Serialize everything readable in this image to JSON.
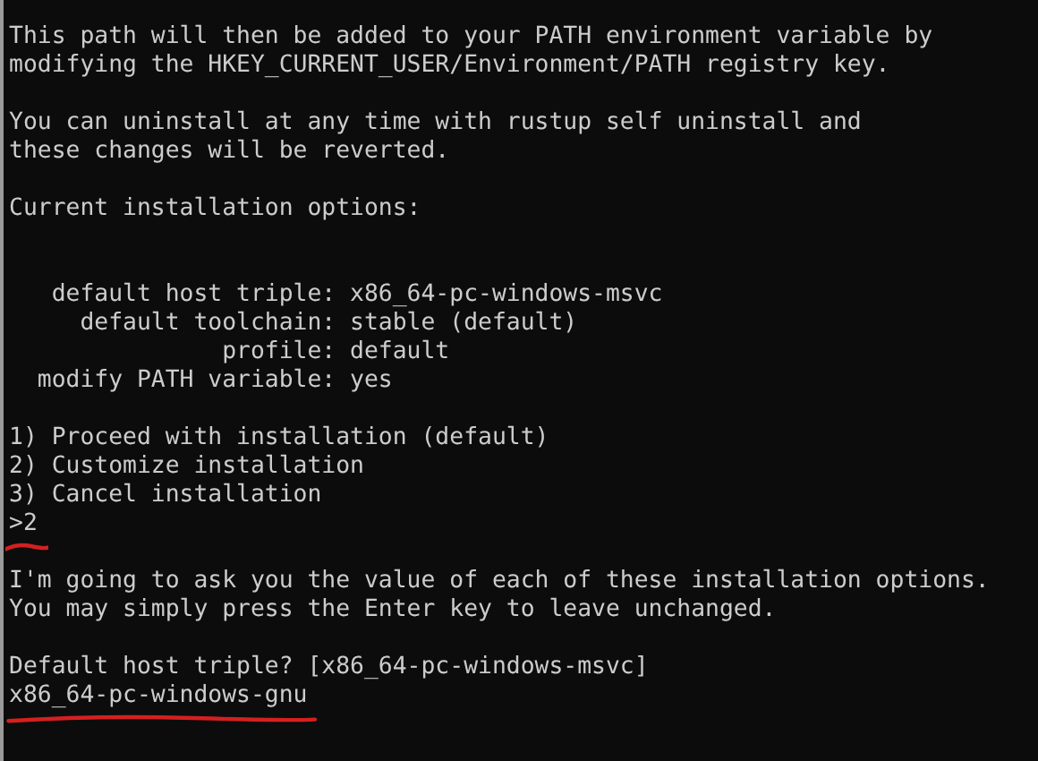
{
  "terminal": {
    "lines": [
      {
        "kind": "text",
        "text": "This path will then be added to your PATH environment variable by"
      },
      {
        "kind": "text",
        "text": "modifying the HKEY_CURRENT_USER/Environment/PATH registry key."
      },
      {
        "kind": "blank"
      },
      {
        "kind": "text",
        "text": "You can uninstall at any time with rustup self uninstall and"
      },
      {
        "kind": "text",
        "text": "these changes will be reverted."
      },
      {
        "kind": "blank"
      },
      {
        "kind": "text",
        "text": "Current installation options:"
      },
      {
        "kind": "blank"
      },
      {
        "kind": "blank"
      },
      {
        "kind": "option",
        "label": "default host triple:",
        "value": "x86_64-pc-windows-msvc"
      },
      {
        "kind": "option",
        "label": "default toolchain:",
        "value": "stable (default)"
      },
      {
        "kind": "option",
        "label": "profile:",
        "value": "default"
      },
      {
        "kind": "option",
        "label": "modify PATH variable:",
        "value": "yes"
      },
      {
        "kind": "blank"
      },
      {
        "kind": "text",
        "text": "1) Proceed with installation (default)"
      },
      {
        "kind": "text",
        "text": "2) Customize installation"
      },
      {
        "kind": "text",
        "text": "3) Cancel installation"
      },
      {
        "kind": "input",
        "text": ">2",
        "annotated": true
      },
      {
        "kind": "blank"
      },
      {
        "kind": "text",
        "text": "I'm going to ask you the value of each of these installation options."
      },
      {
        "kind": "text",
        "text": "You may simply press the Enter key to leave unchanged."
      },
      {
        "kind": "blank"
      },
      {
        "kind": "text",
        "text": "Default host triple? [x86_64-pc-windows-msvc]"
      },
      {
        "kind": "input",
        "text": "x86_64-pc-windows-gnu",
        "annotated": true
      }
    ]
  }
}
